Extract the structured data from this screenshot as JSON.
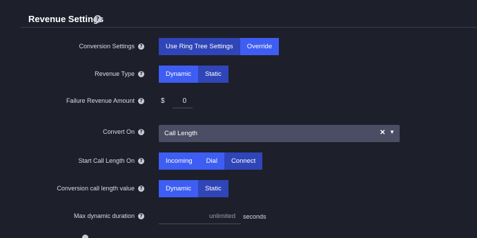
{
  "section": {
    "title": "Revenue Settings",
    "help_icon": "question-circle-icon"
  },
  "rows": {
    "conversion_settings": {
      "label": "Conversion Settings",
      "options": [
        "Use Ring Tree Settings",
        "Override"
      ],
      "selected": "Use Ring Tree Settings"
    },
    "revenue_type": {
      "label": "Revenue Type",
      "options": [
        "Dynamic",
        "Static"
      ],
      "selected": "Static"
    },
    "failure_revenue_amount": {
      "label": "Failure Revenue Amount",
      "currency": "$",
      "value": "0"
    },
    "convert_on": {
      "label": "Convert On",
      "value": "Call Length",
      "clear_icon": "close-icon",
      "caret_icon": "caret-down-icon"
    },
    "start_call_length_on": {
      "label": "Start Call Length On",
      "options": [
        "Incoming",
        "Dial",
        "Connect"
      ],
      "selected": "Connect"
    },
    "conversion_call_length_value": {
      "label": "Conversion call length value",
      "options": [
        "Dynamic",
        "Static"
      ],
      "selected": "Static"
    },
    "max_dynamic_duration": {
      "label": "Max dynamic duration",
      "placeholder": "unlimited",
      "unit": "seconds"
    }
  },
  "colors": {
    "background": "#1d1f2b",
    "button": "#2f45b8",
    "button_active": "#3e5df2",
    "select_bg": "#4a4d63"
  }
}
